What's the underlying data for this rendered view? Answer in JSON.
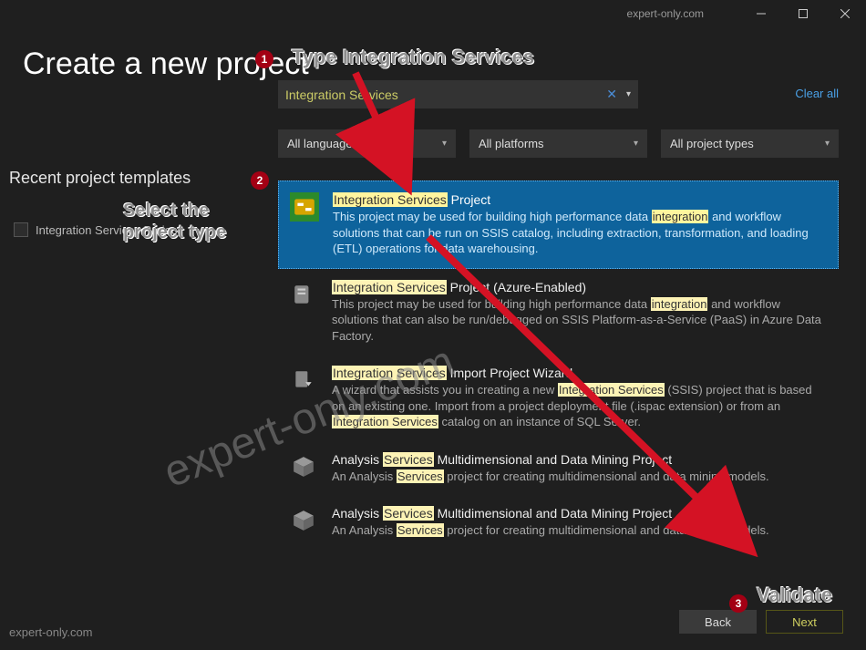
{
  "titlebar": {
    "site": "expert-only.com"
  },
  "page_title": "Create a new project",
  "recent": {
    "header": "Recent project templates",
    "item": "Integration Services Project"
  },
  "search": {
    "value": "Integration Services"
  },
  "clear_all": "Clear all",
  "filters": {
    "languages": "All languages",
    "platforms": "All platforms",
    "types": "All project types"
  },
  "templates": [
    {
      "title_hl_prefix": "Integration Services",
      "title_rest": " Project",
      "desc_a": "This project may be used for building high performance data ",
      "desc_hl1": "integration",
      "desc_b": " and workflow solutions that can be run on SSIS catalog, including extraction, transformation, and loading (ETL) operations for data warehousing.",
      "selected": true
    },
    {
      "title_hl_prefix": "Integration Services",
      "title_rest": " Project (Azure-Enabled)",
      "desc_a": "This project may be used for building high performance data ",
      "desc_hl1": "integration",
      "desc_b": " and workflow solutions that can also be run/debugged on SSIS Platform-as-a-Service (PaaS) in Azure Data Factory."
    },
    {
      "title_hl_prefix": "Integration Services",
      "title_rest": " Import Project Wizard",
      "desc_a": "A wizard that assists you in creating a new ",
      "desc_hl1": "Integration Services",
      "desc_b": " (SSIS) project that is based on an existing one. Import from a project deployment file (.ispac extension) or from an ",
      "desc_hl2": "Integration Services",
      "desc_c": " catalog on an instance of SQL Server."
    },
    {
      "title_a": "Analysis ",
      "title_hl_prefix": "Services",
      "title_rest": " Multidimensional and Data Mining Project",
      "desc_a": "An Analysis ",
      "desc_hl1": "Services",
      "desc_b": " project for creating multidimensional and data mining models."
    },
    {
      "title_a": "Analysis ",
      "title_hl_prefix": "Services",
      "title_rest": " Multidimensional and Data Mining Project",
      "desc_a": "An Analysis ",
      "desc_hl1": "Services",
      "desc_b": " project for creating multidimensional and data mining models."
    }
  ],
  "buttons": {
    "back": "Back",
    "next": "Next"
  },
  "annotations": {
    "step1_label": "Type Integration Services",
    "step2_label1": "Select the",
    "step2_label2": "project type",
    "step3_label": "Validate",
    "b1": "1",
    "b2": "2",
    "b3": "3"
  },
  "watermark": {
    "center": "expert-only.com",
    "bottom": "expert-only.com"
  }
}
